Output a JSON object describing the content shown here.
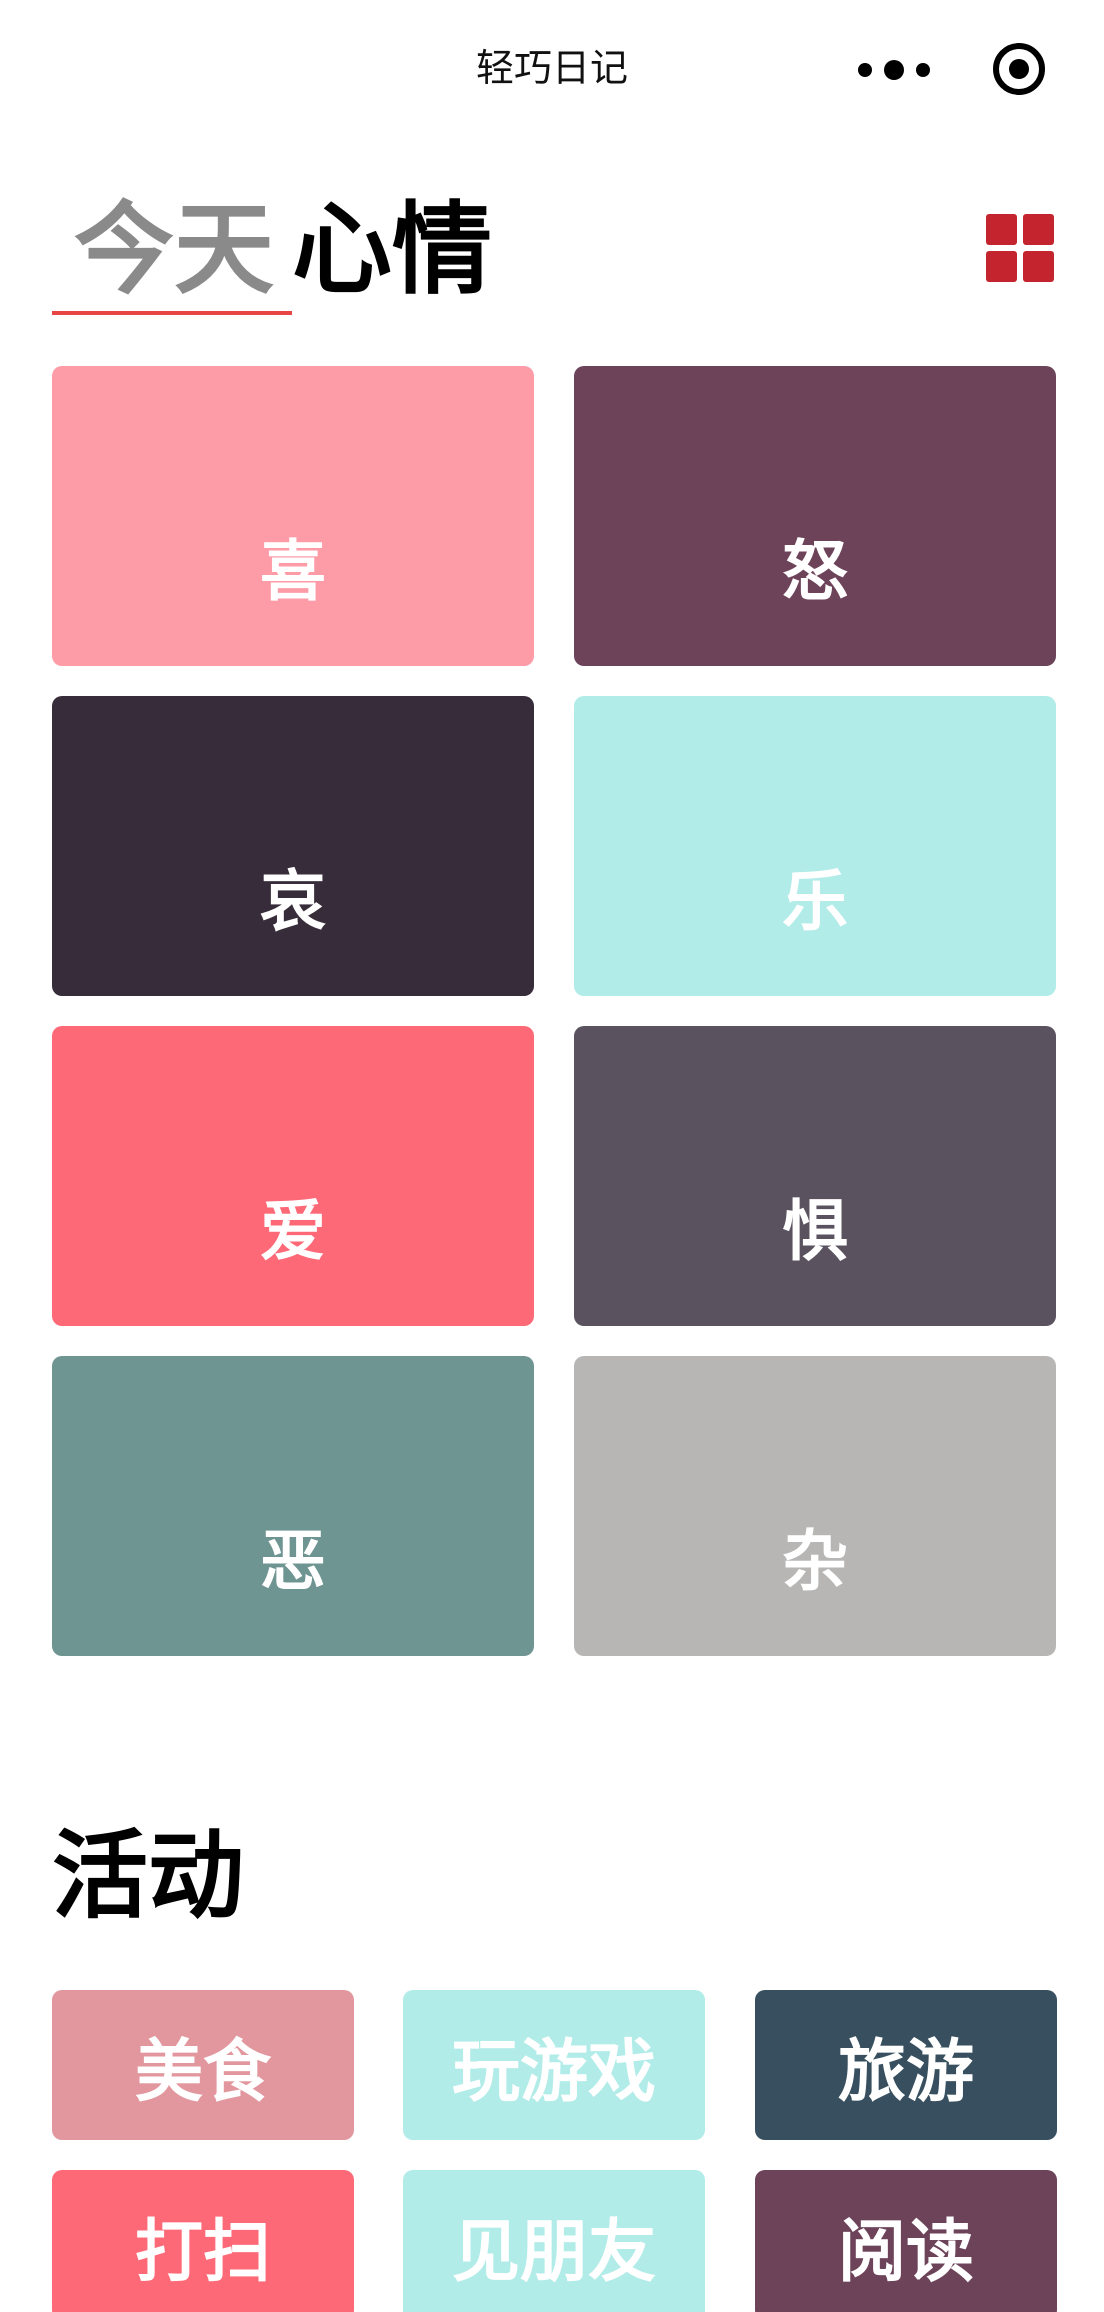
{
  "navbar": {
    "title": "轻巧日记"
  },
  "header": {
    "tab_today": "今天",
    "tab_mood": "心情"
  },
  "moods": [
    {
      "label": "喜",
      "color": "#fd9ba7"
    },
    {
      "label": "怒",
      "color": "#6c4359"
    },
    {
      "label": "哀",
      "color": "#372d3a"
    },
    {
      "label": "乐",
      "color": "#b1ece8"
    },
    {
      "label": "爱",
      "color": "#fe6977"
    },
    {
      "label": "惧",
      "color": "#5a535f"
    },
    {
      "label": "恶",
      "color": "#6e9591"
    },
    {
      "label": "杂",
      "color": "#b7b6b5"
    }
  ],
  "activities": {
    "title": "活动",
    "items": [
      {
        "label": "美食",
        "color": "#e2979e"
      },
      {
        "label": "玩游戏",
        "color": "#b1ece8"
      },
      {
        "label": "旅游",
        "color": "#374f5e"
      },
      {
        "label": "打扫",
        "color": "#fe6977"
      },
      {
        "label": "见朋友",
        "color": "#b1ece8"
      },
      {
        "label": "阅读",
        "color": "#6c4359"
      }
    ]
  }
}
